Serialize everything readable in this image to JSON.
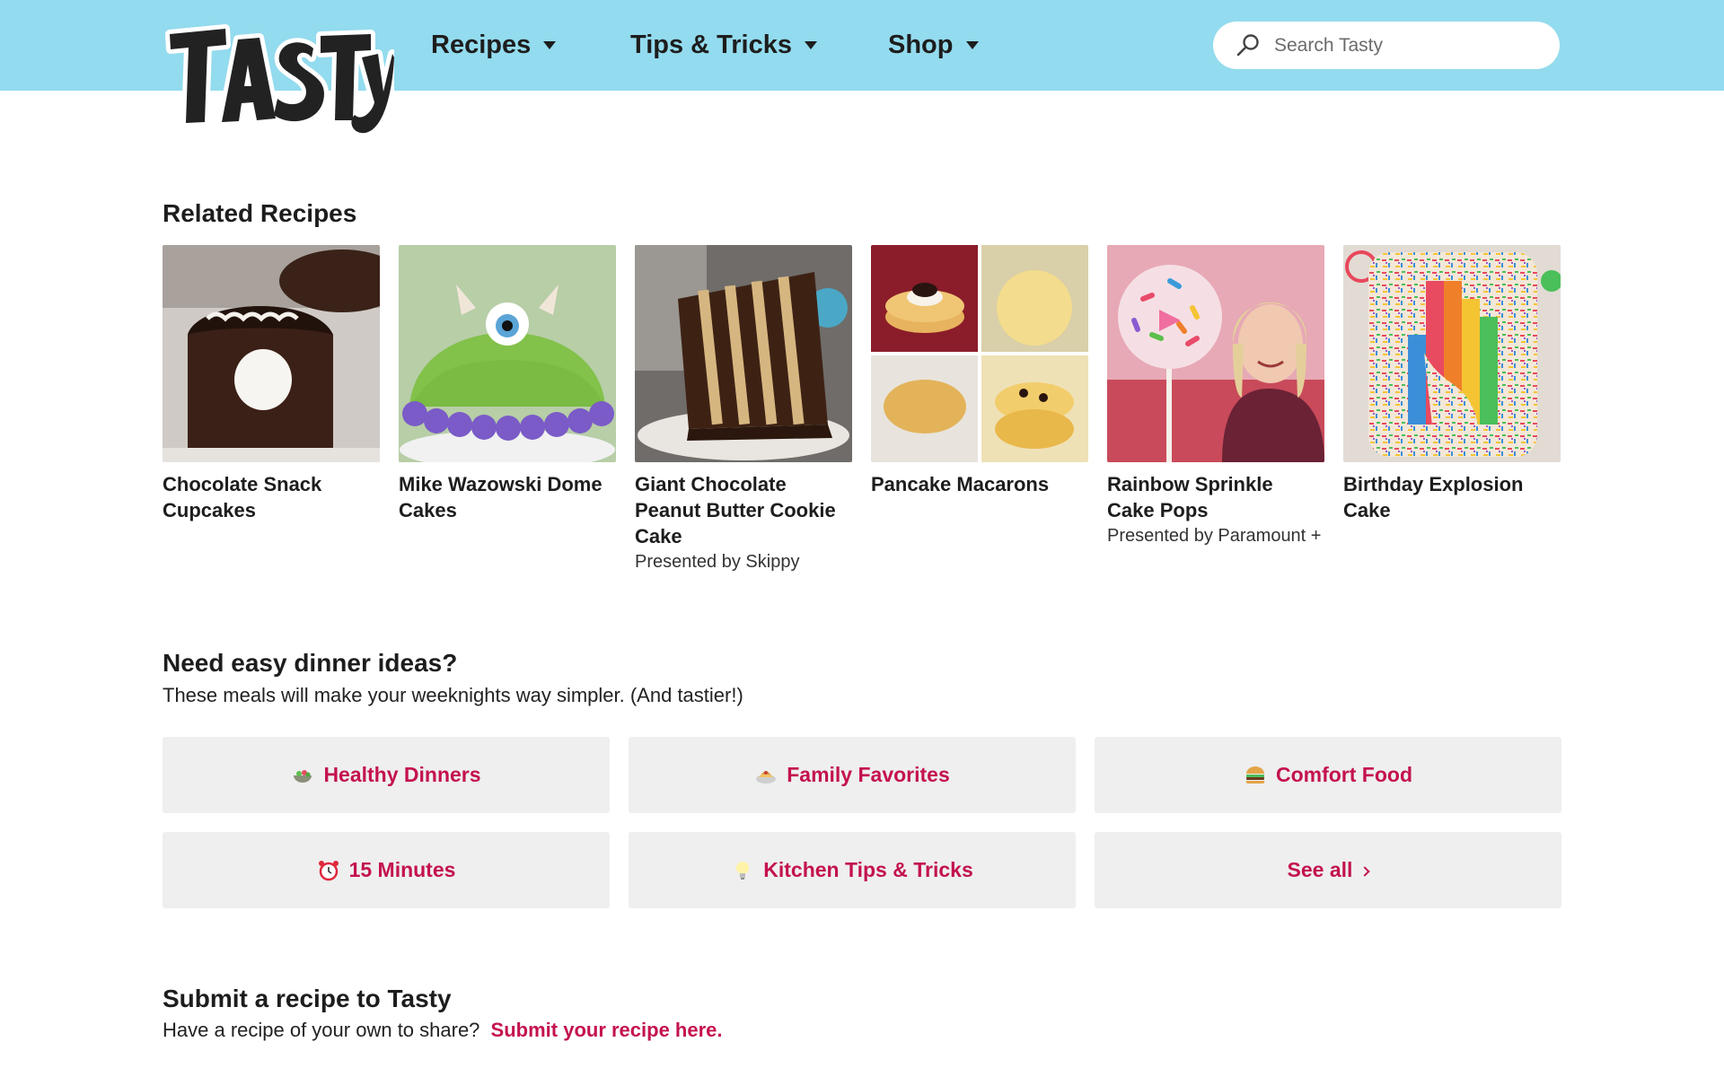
{
  "brand": {
    "logo_text": "TASTY",
    "accent": "#c4124e",
    "header_bg": "#93dbee"
  },
  "nav": {
    "items": [
      {
        "label": "Recipes"
      },
      {
        "label": "Tips & Tricks"
      },
      {
        "label": "Shop"
      }
    ]
  },
  "search": {
    "placeholder": "Search Tasty",
    "value": "",
    "icon": "search-icon"
  },
  "related": {
    "title": "Related Recipes",
    "cards": [
      {
        "name": "Chocolate Snack Cupcakes",
        "sponsor": ""
      },
      {
        "name": "Mike Wazowski Dome Cakes",
        "sponsor": ""
      },
      {
        "name": "Giant Chocolate Peanut Butter Cookie Cake",
        "sponsor": "Presented by Skippy"
      },
      {
        "name": "Pancake Macarons",
        "sponsor": ""
      },
      {
        "name": "Rainbow Sprinkle Cake Pops",
        "sponsor": "Presented by Paramount +"
      },
      {
        "name": "Birthday Explosion Cake",
        "sponsor": ""
      }
    ]
  },
  "dinner": {
    "title": "Need easy dinner ideas?",
    "subtitle": "These meals will make your weeknights way simpler. (And tastier!)",
    "buttons": [
      {
        "label": "Healthy Dinners",
        "icon": "salad-bowl-icon"
      },
      {
        "label": "Family Favorites",
        "icon": "spaghetti-icon"
      },
      {
        "label": "Comfort Food",
        "icon": "burger-icon"
      },
      {
        "label": "15 Minutes",
        "icon": "alarm-clock-icon"
      },
      {
        "label": "Kitchen Tips & Tricks",
        "icon": "light-bulb-icon"
      },
      {
        "label": "See all",
        "icon": "chevron-right-icon"
      }
    ]
  },
  "submit": {
    "title": "Submit a recipe to Tasty",
    "text": "Have a recipe of your own to share?",
    "link": "Submit your recipe here."
  }
}
